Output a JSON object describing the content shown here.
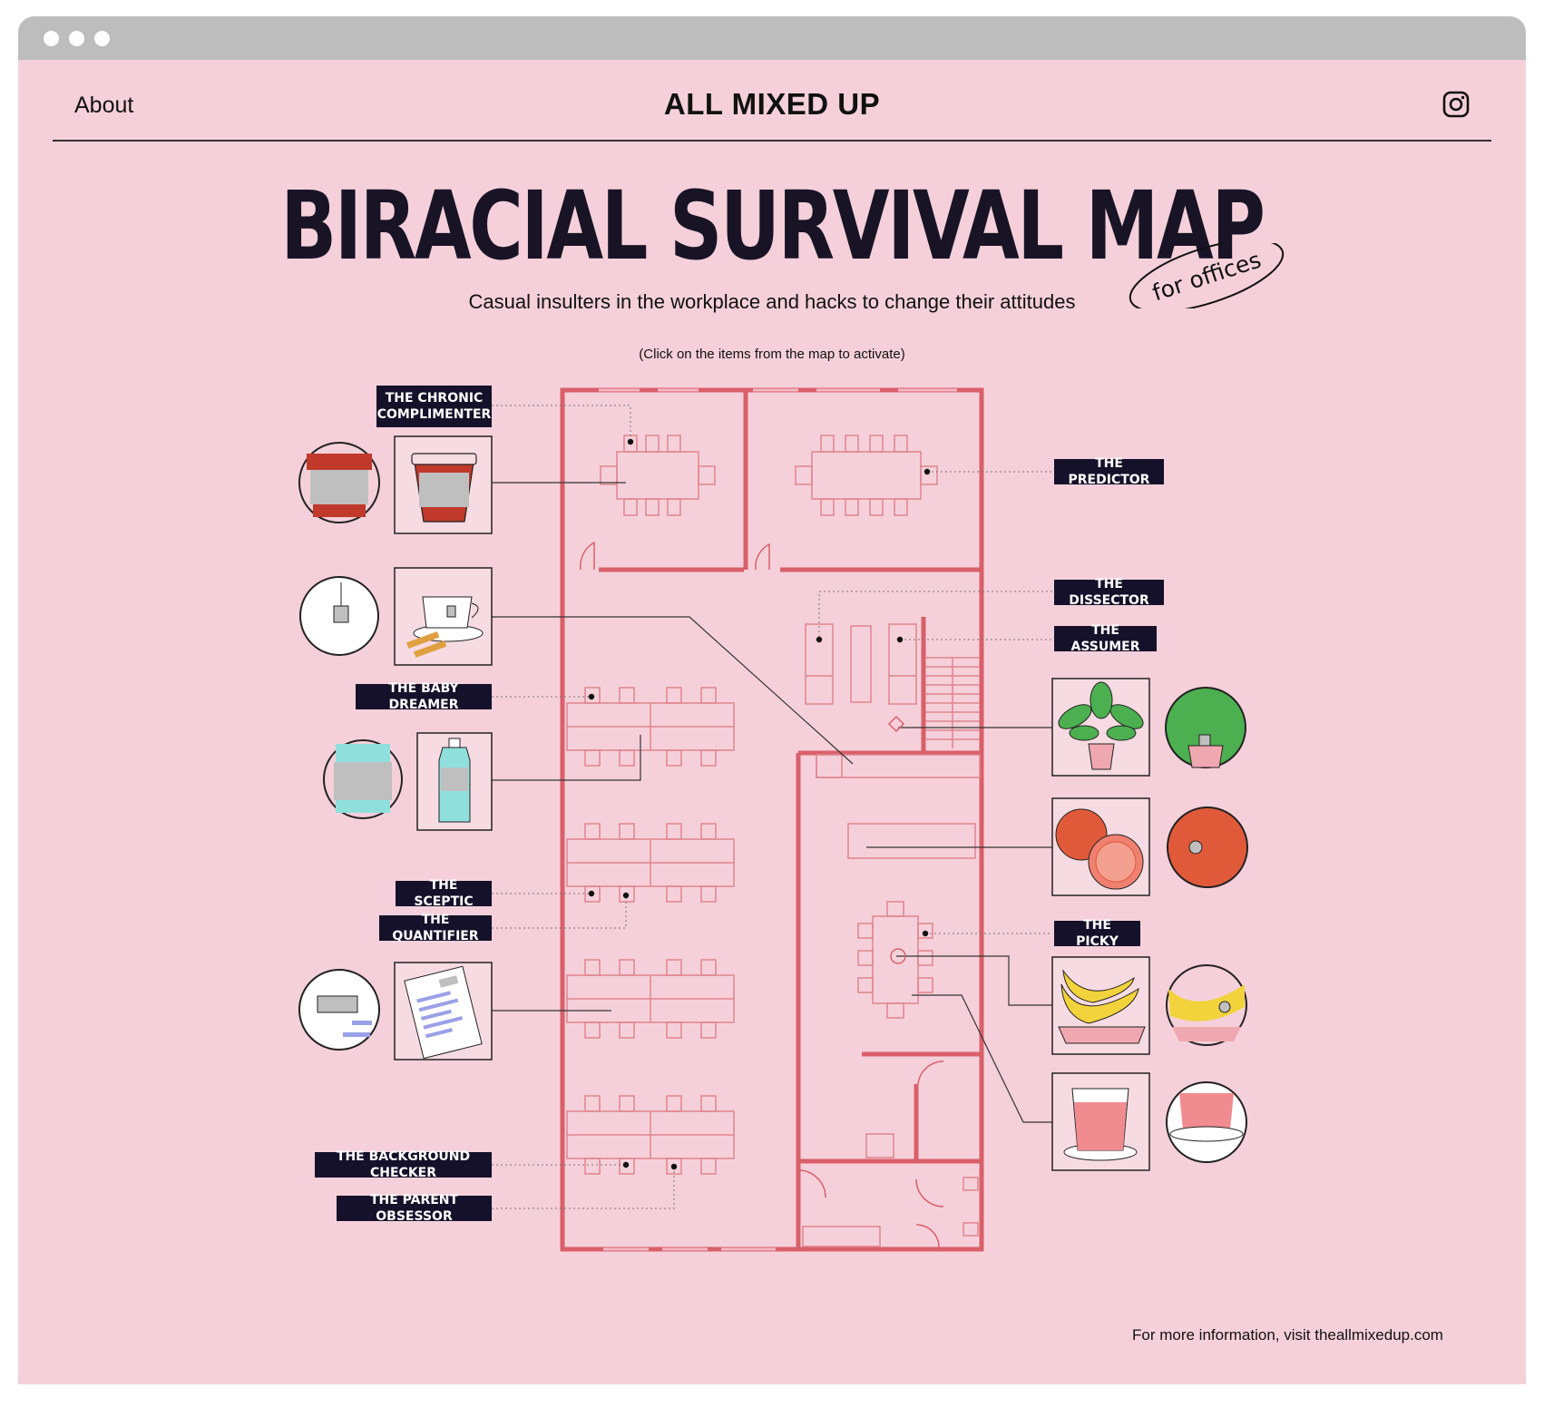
{
  "header": {
    "about_label": "About",
    "brand": "ALL MIXED UP",
    "instagram_icon": "instagram-icon"
  },
  "hero": {
    "title": "BIRACIAL SURVIVAL MAP",
    "badge": "for offices",
    "subtitle": "Casual insulters in the workplace and hacks to change their attitudes",
    "instruction": "(Click on the items from the map to activate)"
  },
  "labels": {
    "chronic_complimenter": "THE CHRONIC COMPLIMENTER",
    "predictor": "THE PREDICTOR",
    "dissector": "THE DISSECTOR",
    "assumer": "THE ASSUMER",
    "baby_dreamer": "THE BABY DREAMER",
    "sceptic": "THE SCEPTIC",
    "quantifier": "THE QUANTIFIER",
    "picky": "THE PICKY",
    "background_checker": "THE BACKGROUND CHECKER",
    "parent_obsessor": "THE PARENT OBSESSOR"
  },
  "items": [
    "coffee-cup",
    "tea-cup",
    "water-bottle",
    "document",
    "plant",
    "grapefruit",
    "bananas",
    "juice-glass"
  ],
  "footer": {
    "info": "For more information, visit theallmixedup.com"
  },
  "colors": {
    "background": "#f5d0da",
    "wall": "#d9606a",
    "furniture": "#e0848c",
    "label_bg": "#15112a",
    "chrome": "#bdbdbd"
  }
}
